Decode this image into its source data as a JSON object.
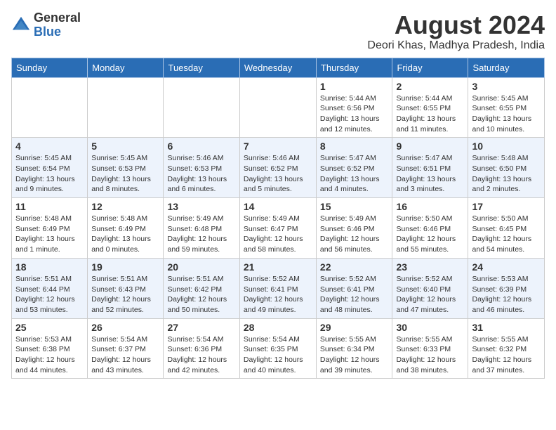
{
  "logo": {
    "general": "General",
    "blue": "Blue"
  },
  "header": {
    "month_title": "August 2024",
    "location": "Deori Khas, Madhya Pradesh, India"
  },
  "weekdays": [
    "Sunday",
    "Monday",
    "Tuesday",
    "Wednesday",
    "Thursday",
    "Friday",
    "Saturday"
  ],
  "weeks": [
    [
      {
        "day": "",
        "info": ""
      },
      {
        "day": "",
        "info": ""
      },
      {
        "day": "",
        "info": ""
      },
      {
        "day": "",
        "info": ""
      },
      {
        "day": "1",
        "info": "Sunrise: 5:44 AM\nSunset: 6:56 PM\nDaylight: 13 hours\nand 12 minutes."
      },
      {
        "day": "2",
        "info": "Sunrise: 5:44 AM\nSunset: 6:55 PM\nDaylight: 13 hours\nand 11 minutes."
      },
      {
        "day": "3",
        "info": "Sunrise: 5:45 AM\nSunset: 6:55 PM\nDaylight: 13 hours\nand 10 minutes."
      }
    ],
    [
      {
        "day": "4",
        "info": "Sunrise: 5:45 AM\nSunset: 6:54 PM\nDaylight: 13 hours\nand 9 minutes."
      },
      {
        "day": "5",
        "info": "Sunrise: 5:45 AM\nSunset: 6:53 PM\nDaylight: 13 hours\nand 8 minutes."
      },
      {
        "day": "6",
        "info": "Sunrise: 5:46 AM\nSunset: 6:53 PM\nDaylight: 13 hours\nand 6 minutes."
      },
      {
        "day": "7",
        "info": "Sunrise: 5:46 AM\nSunset: 6:52 PM\nDaylight: 13 hours\nand 5 minutes."
      },
      {
        "day": "8",
        "info": "Sunrise: 5:47 AM\nSunset: 6:52 PM\nDaylight: 13 hours\nand 4 minutes."
      },
      {
        "day": "9",
        "info": "Sunrise: 5:47 AM\nSunset: 6:51 PM\nDaylight: 13 hours\nand 3 minutes."
      },
      {
        "day": "10",
        "info": "Sunrise: 5:48 AM\nSunset: 6:50 PM\nDaylight: 13 hours\nand 2 minutes."
      }
    ],
    [
      {
        "day": "11",
        "info": "Sunrise: 5:48 AM\nSunset: 6:49 PM\nDaylight: 13 hours\nand 1 minute."
      },
      {
        "day": "12",
        "info": "Sunrise: 5:48 AM\nSunset: 6:49 PM\nDaylight: 13 hours\nand 0 minutes."
      },
      {
        "day": "13",
        "info": "Sunrise: 5:49 AM\nSunset: 6:48 PM\nDaylight: 12 hours\nand 59 minutes."
      },
      {
        "day": "14",
        "info": "Sunrise: 5:49 AM\nSunset: 6:47 PM\nDaylight: 12 hours\nand 58 minutes."
      },
      {
        "day": "15",
        "info": "Sunrise: 5:49 AM\nSunset: 6:46 PM\nDaylight: 12 hours\nand 56 minutes."
      },
      {
        "day": "16",
        "info": "Sunrise: 5:50 AM\nSunset: 6:46 PM\nDaylight: 12 hours\nand 55 minutes."
      },
      {
        "day": "17",
        "info": "Sunrise: 5:50 AM\nSunset: 6:45 PM\nDaylight: 12 hours\nand 54 minutes."
      }
    ],
    [
      {
        "day": "18",
        "info": "Sunrise: 5:51 AM\nSunset: 6:44 PM\nDaylight: 12 hours\nand 53 minutes."
      },
      {
        "day": "19",
        "info": "Sunrise: 5:51 AM\nSunset: 6:43 PM\nDaylight: 12 hours\nand 52 minutes."
      },
      {
        "day": "20",
        "info": "Sunrise: 5:51 AM\nSunset: 6:42 PM\nDaylight: 12 hours\nand 50 minutes."
      },
      {
        "day": "21",
        "info": "Sunrise: 5:52 AM\nSunset: 6:41 PM\nDaylight: 12 hours\nand 49 minutes."
      },
      {
        "day": "22",
        "info": "Sunrise: 5:52 AM\nSunset: 6:41 PM\nDaylight: 12 hours\nand 48 minutes."
      },
      {
        "day": "23",
        "info": "Sunrise: 5:52 AM\nSunset: 6:40 PM\nDaylight: 12 hours\nand 47 minutes."
      },
      {
        "day": "24",
        "info": "Sunrise: 5:53 AM\nSunset: 6:39 PM\nDaylight: 12 hours\nand 46 minutes."
      }
    ],
    [
      {
        "day": "25",
        "info": "Sunrise: 5:53 AM\nSunset: 6:38 PM\nDaylight: 12 hours\nand 44 minutes."
      },
      {
        "day": "26",
        "info": "Sunrise: 5:54 AM\nSunset: 6:37 PM\nDaylight: 12 hours\nand 43 minutes."
      },
      {
        "day": "27",
        "info": "Sunrise: 5:54 AM\nSunset: 6:36 PM\nDaylight: 12 hours\nand 42 minutes."
      },
      {
        "day": "28",
        "info": "Sunrise: 5:54 AM\nSunset: 6:35 PM\nDaylight: 12 hours\nand 40 minutes."
      },
      {
        "day": "29",
        "info": "Sunrise: 5:55 AM\nSunset: 6:34 PM\nDaylight: 12 hours\nand 39 minutes."
      },
      {
        "day": "30",
        "info": "Sunrise: 5:55 AM\nSunset: 6:33 PM\nDaylight: 12 hours\nand 38 minutes."
      },
      {
        "day": "31",
        "info": "Sunrise: 5:55 AM\nSunset: 6:32 PM\nDaylight: 12 hours\nand 37 minutes."
      }
    ]
  ]
}
